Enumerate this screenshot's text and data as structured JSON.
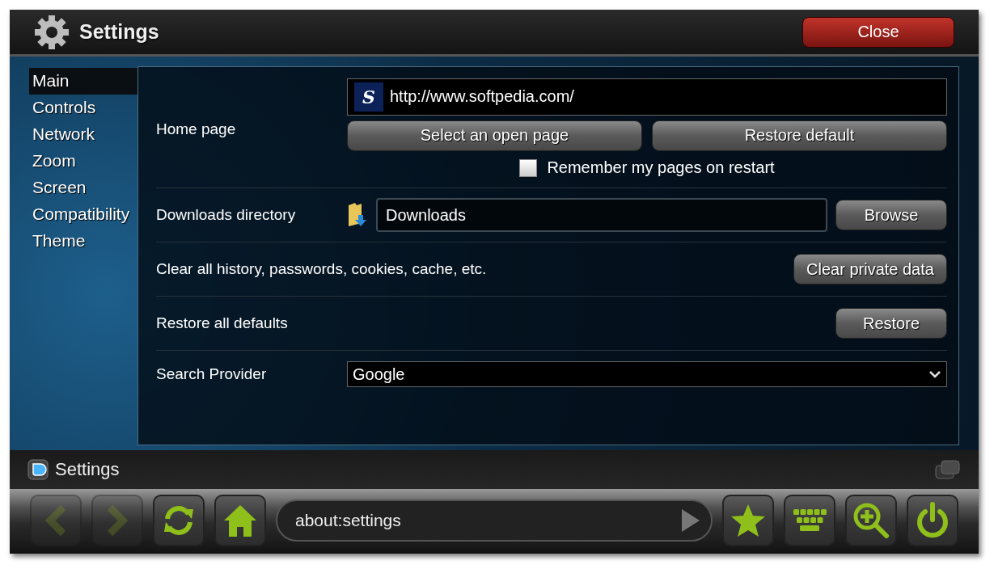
{
  "header": {
    "title": "Settings",
    "close_button": "Close"
  },
  "sidebar": {
    "items": [
      {
        "label": "Main",
        "selected": true
      },
      {
        "label": "Controls",
        "selected": false
      },
      {
        "label": "Network",
        "selected": false
      },
      {
        "label": "Zoom",
        "selected": false
      },
      {
        "label": "Screen",
        "selected": false
      },
      {
        "label": "Compatibility",
        "selected": false
      },
      {
        "label": "Theme",
        "selected": false
      }
    ]
  },
  "home_page": {
    "label": "Home page",
    "site_badge": "S",
    "url": "http://www.softpedia.com/",
    "buttons": [
      "Select an open page",
      "Restore default"
    ],
    "remember": {
      "label": "Remember my pages on restart",
      "checked": false
    }
  },
  "downloads": {
    "label": "Downloads directory",
    "value": "Downloads",
    "button": "Browse"
  },
  "actions": [
    {
      "label": "Clear all history, passwords, cookies, cache, etc.",
      "button": "Clear private data"
    },
    {
      "label": "Restore all defaults",
      "button": "Restore"
    }
  ],
  "search_provider": {
    "label": "Search Provider",
    "value": "Google"
  },
  "tab_bar": {
    "title": "Settings"
  },
  "toolbar": {
    "left_buttons": [
      {
        "kind": "back",
        "disabled": true
      },
      {
        "kind": "forward",
        "disabled": true
      },
      {
        "kind": "reload",
        "disabled": false
      },
      {
        "kind": "home",
        "disabled": false
      }
    ],
    "address": "about:settings",
    "right_buttons": [
      {
        "kind": "bookmark",
        "disabled": false
      },
      {
        "kind": "keyboard",
        "disabled": false
      },
      {
        "kind": "zoom",
        "disabled": false
      },
      {
        "kind": "power",
        "disabled": false
      }
    ]
  }
}
